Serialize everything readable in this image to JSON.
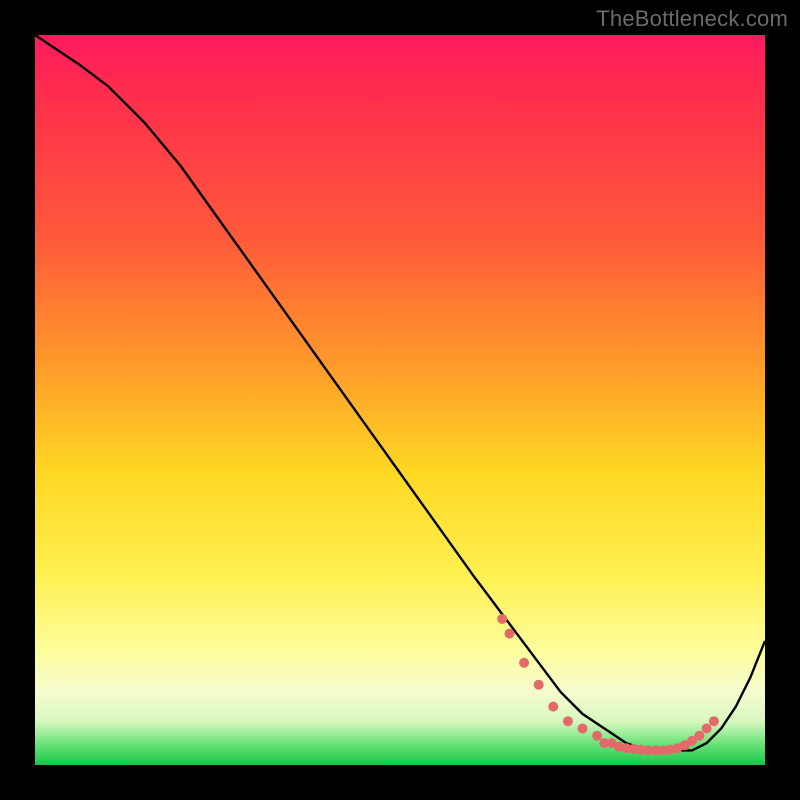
{
  "watermark": "TheBottleneck.com",
  "colors": {
    "curve": "#000000",
    "markers": "#e46a6a",
    "frame_bg": "#000000"
  },
  "chart_data": {
    "type": "line",
    "title": "",
    "xlabel": "",
    "ylabel": "",
    "xlim": [
      0,
      100
    ],
    "ylim": [
      0,
      100
    ],
    "grid": false,
    "legend": false,
    "series": [
      {
        "name": "curve",
        "x": [
          0,
          3,
          6,
          10,
          15,
          20,
          25,
          30,
          35,
          40,
          45,
          50,
          55,
          60,
          63,
          66,
          69,
          72,
          75,
          78,
          81,
          84,
          87,
          90,
          92,
          94,
          96,
          98,
          100
        ],
        "y": [
          100,
          98,
          96,
          93,
          88,
          82,
          75,
          68,
          61,
          54,
          47,
          40,
          33,
          26,
          22,
          18,
          14,
          10,
          7,
          5,
          3,
          2,
          2,
          2,
          3,
          5,
          8,
          12,
          17
        ]
      }
    ],
    "markers": {
      "name": "highlight",
      "color": "#e46a6a",
      "points": [
        {
          "x": 64,
          "y": 20
        },
        {
          "x": 65,
          "y": 18
        },
        {
          "x": 67,
          "y": 14
        },
        {
          "x": 69,
          "y": 11
        },
        {
          "x": 71,
          "y": 8
        },
        {
          "x": 73,
          "y": 6
        },
        {
          "x": 75,
          "y": 5
        },
        {
          "x": 77,
          "y": 4
        },
        {
          "x": 78,
          "y": 3
        },
        {
          "x": 79,
          "y": 3
        },
        {
          "x": 80,
          "y": 2.5
        },
        {
          "x": 81,
          "y": 2.3
        },
        {
          "x": 82,
          "y": 2.2
        },
        {
          "x": 83,
          "y": 2.1
        },
        {
          "x": 84,
          "y": 2
        },
        {
          "x": 85,
          "y": 2
        },
        {
          "x": 86,
          "y": 2
        },
        {
          "x": 87,
          "y": 2.1
        },
        {
          "x": 88,
          "y": 2.3
        },
        {
          "x": 89,
          "y": 2.7
        },
        {
          "x": 90,
          "y": 3.3
        },
        {
          "x": 91,
          "y": 4
        },
        {
          "x": 92,
          "y": 5
        },
        {
          "x": 93,
          "y": 6
        }
      ]
    }
  }
}
